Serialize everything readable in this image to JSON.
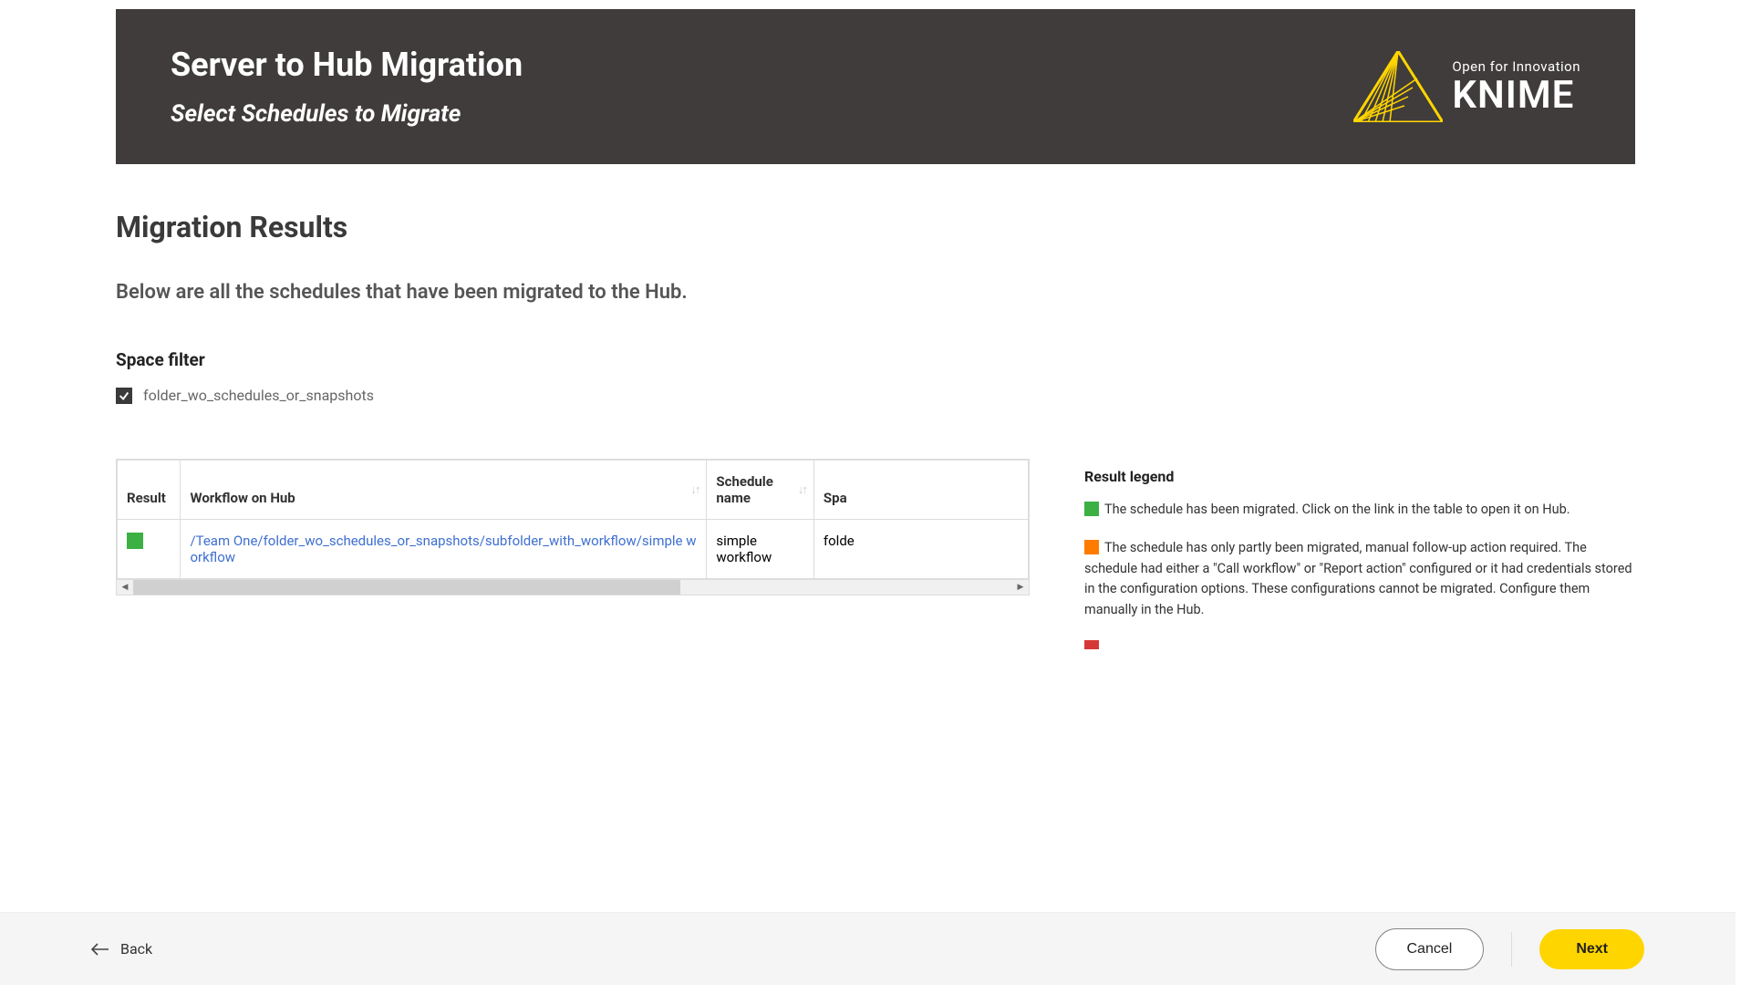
{
  "header": {
    "title": "Server to Hub Migration",
    "subtitle": "Select Schedules to Migrate",
    "logo_tagline": "Open for Innovation",
    "logo_brand": "KNIME"
  },
  "section": {
    "title": "Migration Results",
    "description": "Below are all the schedules that have been migrated to the Hub."
  },
  "filter": {
    "label": "Space filter",
    "option1": "folder_wo_schedules_or_snapshots"
  },
  "table": {
    "headers": {
      "result": "Result",
      "workflow": "Workflow on Hub",
      "schedule": "Schedule name",
      "space": "Spa"
    },
    "rows": [
      {
        "status_color": "#3cb043",
        "workflow_link": "/Team One/folder_wo_schedules_or_snapshots/subfolder_with_workflow/simple workflow",
        "schedule_name": "simple workflow",
        "space": "folde"
      }
    ]
  },
  "legend": {
    "title": "Result legend",
    "green_text": "The schedule has been migrated. Click on the link in the table to open it on Hub.",
    "orange_text": "The schedule has only partly been migrated, manual follow-up action required. The schedule had either a \"Call workflow\" or \"Report action\" configured or it had credentials stored in the configuration options. These configurations cannot be migrated. Configure them manually in the Hub.",
    "green_color": "#3cb043",
    "orange_color": "#ff7b00",
    "red_color": "#d63838"
  },
  "footer": {
    "back": "Back",
    "cancel": "Cancel",
    "next": "Next"
  }
}
